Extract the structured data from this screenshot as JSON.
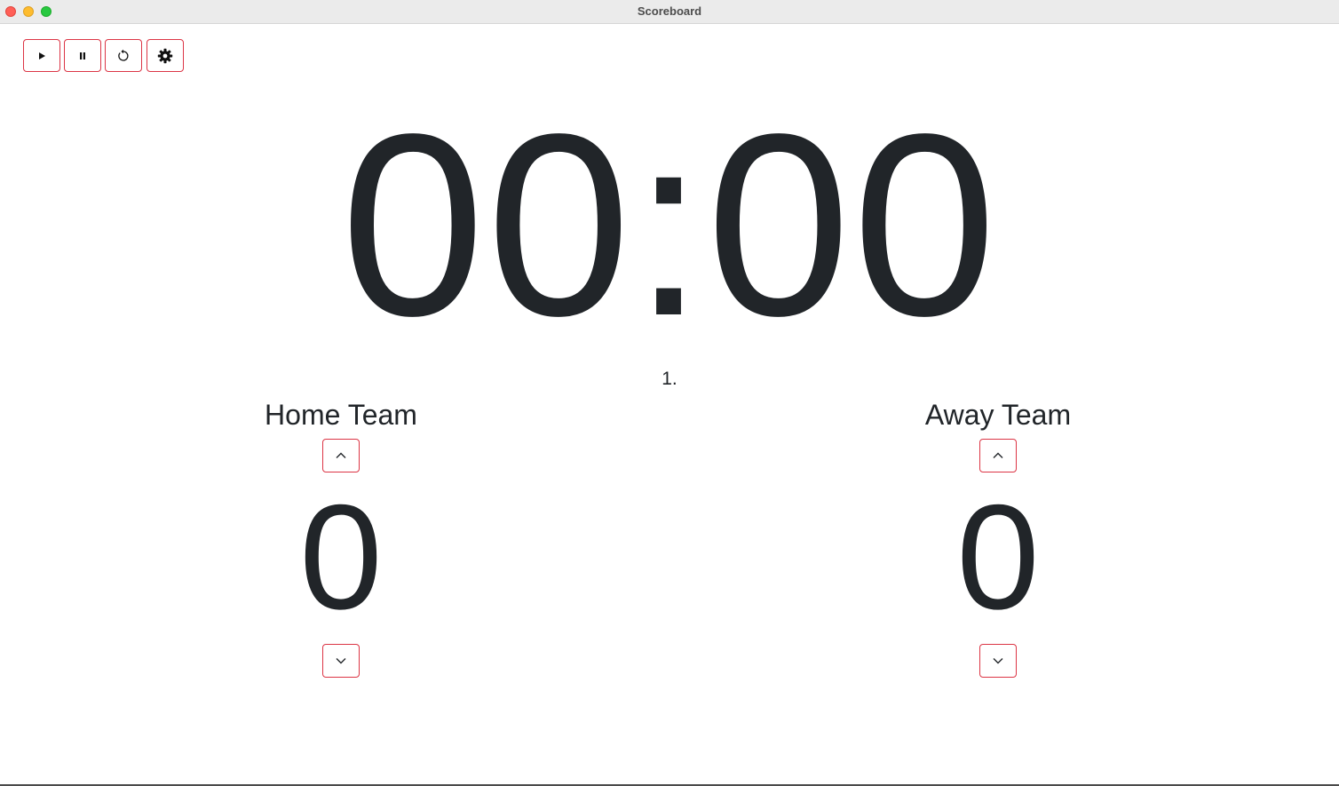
{
  "window": {
    "title": "Scoreboard"
  },
  "toolbar": {
    "buttons": [
      {
        "icon": "play-icon"
      },
      {
        "icon": "pause-icon"
      },
      {
        "icon": "reset-icon"
      },
      {
        "icon": "gear-icon"
      }
    ]
  },
  "clock": {
    "time": "00:00"
  },
  "period": {
    "label": "1."
  },
  "home": {
    "name": "Home Team",
    "score": "0"
  },
  "away": {
    "name": "Away Team",
    "score": "0"
  },
  "colors": {
    "accent_border": "#dc3545",
    "text": "#212529",
    "titlebar": "#ebebeb"
  }
}
